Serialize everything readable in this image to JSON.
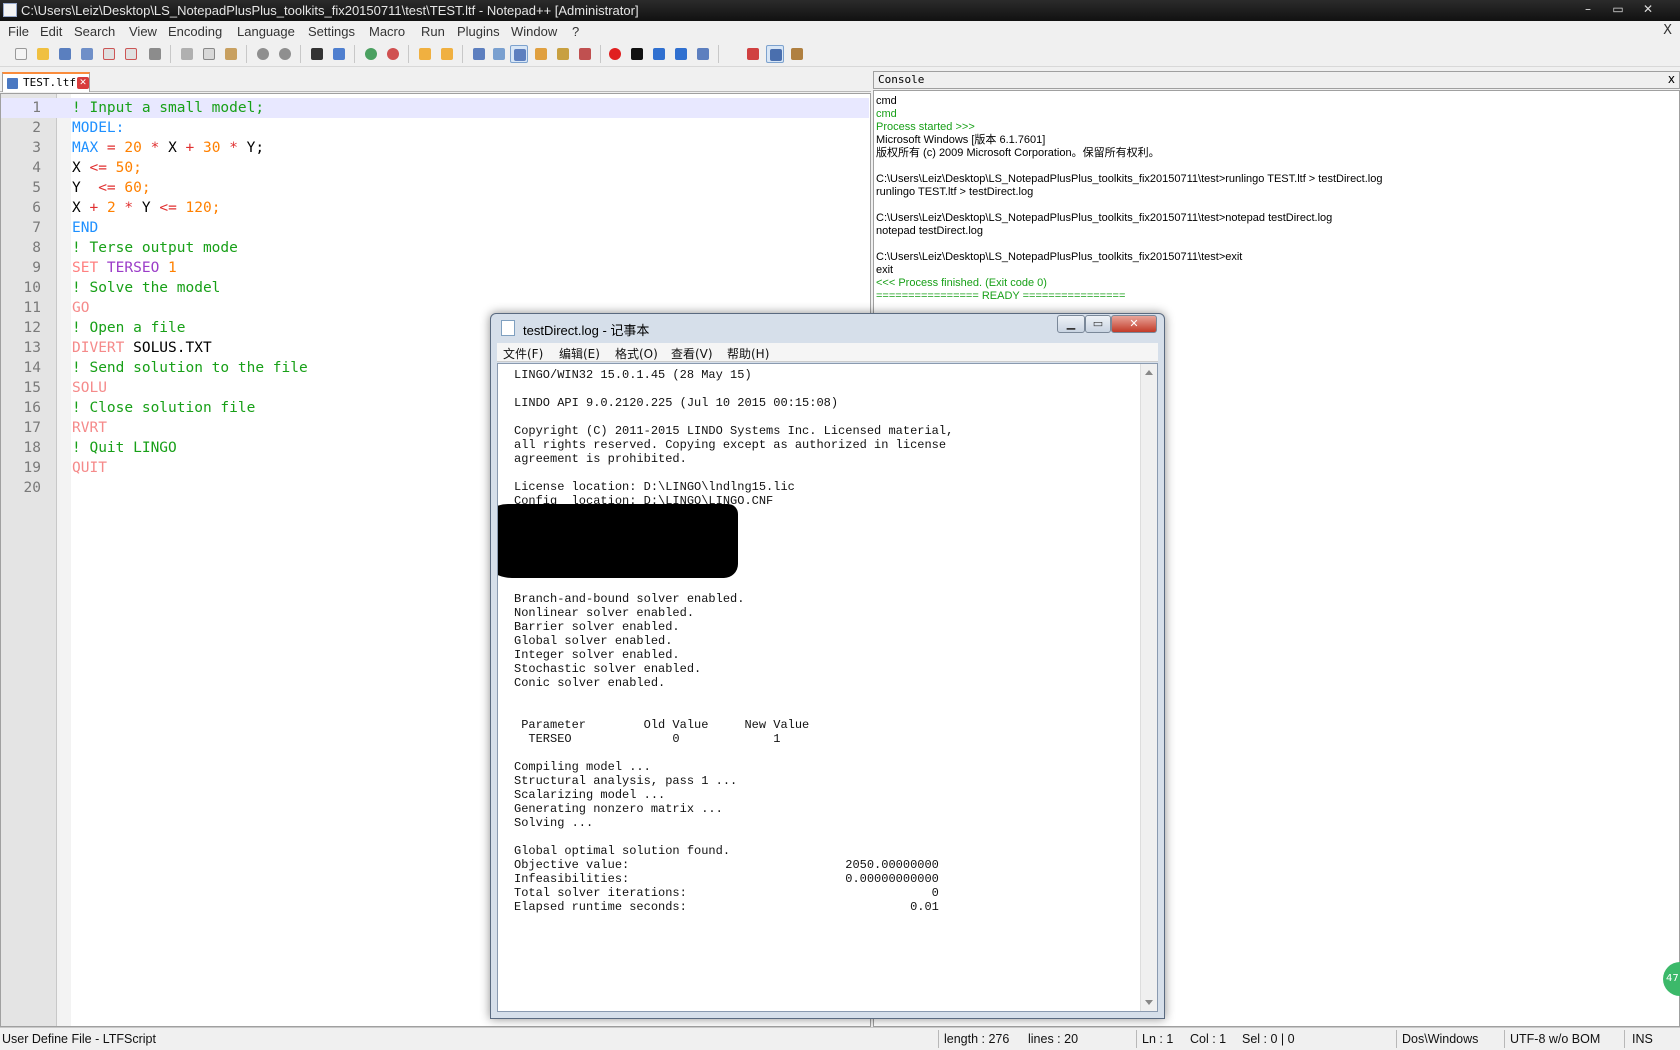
{
  "window": {
    "title": "C:\\Users\\Leiz\\Desktop\\LS_NotepadPlusPlus_toolkits_fix20150711\\test\\TEST.ltf - Notepad++ [Administrator]",
    "minimize": "–",
    "maximize": "▭",
    "close": "✕"
  },
  "menu": [
    "File",
    "Edit",
    "Search",
    "View",
    "Encoding",
    "Language",
    "Settings",
    "Macro",
    "Run",
    "Plugins",
    "Window",
    "?"
  ],
  "menu_close": "X",
  "tab": {
    "label": "TEST.ltf",
    "close": "✕"
  },
  "editor": {
    "lines": [
      [
        [
          "! Input a small model;",
          "comment"
        ]
      ],
      [
        [
          "MODEL:",
          "kw"
        ]
      ],
      [
        [
          "MAX ",
          "kw"
        ],
        [
          "= ",
          "op"
        ],
        [
          "20 ",
          "num"
        ],
        [
          "* ",
          "op"
        ],
        [
          "X ",
          "text"
        ],
        [
          "+ ",
          "op"
        ],
        [
          "30 ",
          "num"
        ],
        [
          "* ",
          "op"
        ],
        [
          "Y;",
          "text"
        ]
      ],
      [
        [
          "X ",
          "text"
        ],
        [
          "<= ",
          "op"
        ],
        [
          "50;",
          "num"
        ]
      ],
      [
        [
          "Y  ",
          "text"
        ],
        [
          "<= ",
          "op"
        ],
        [
          "60;",
          "num"
        ]
      ],
      [
        [
          "X ",
          "text"
        ],
        [
          "+ ",
          "op"
        ],
        [
          "2 ",
          "num"
        ],
        [
          "* ",
          "op"
        ],
        [
          "Y ",
          "text"
        ],
        [
          "<= ",
          "op"
        ],
        [
          "120;",
          "num"
        ]
      ],
      [
        [
          "END",
          "kw"
        ]
      ],
      [
        [
          "! Terse output mode",
          "comment"
        ]
      ],
      [
        [
          "SET ",
          "set"
        ],
        [
          "TERSEO ",
          "purple"
        ],
        [
          "1",
          "num"
        ]
      ],
      [
        [
          "! Solve the model",
          "comment"
        ]
      ],
      [
        [
          "GO",
          "pink"
        ]
      ],
      [
        [
          "! Open a file",
          "comment"
        ]
      ],
      [
        [
          "DIVERT ",
          "pink"
        ],
        [
          "SOLUS.TXT",
          "text"
        ]
      ],
      [
        [
          "! Send solution to the file",
          "comment"
        ]
      ],
      [
        [
          "SOLU",
          "pink"
        ]
      ],
      [
        [
          "! Close solution file",
          "comment"
        ]
      ],
      [
        [
          "RVRT",
          "pink"
        ]
      ],
      [
        [
          "! Quit LINGO",
          "comment"
        ]
      ],
      [
        [
          "QUIT",
          "pink"
        ]
      ],
      []
    ]
  },
  "console": {
    "title": "Console",
    "close": "x",
    "lines": [
      {
        "text": "cmd",
        "style": "black"
      },
      {
        "text": "cmd",
        "style": "green"
      },
      {
        "text": "Process started >>>",
        "style": "green"
      },
      {
        "text": "Microsoft Windows [版本 6.1.7601]",
        "style": "black"
      },
      {
        "text": "版权所有 (c) 2009 Microsoft Corporation。保留所有权利。",
        "style": "black"
      },
      {
        "text": "",
        "style": "black"
      },
      {
        "text": "C:\\Users\\Leiz\\Desktop\\LS_NotepadPlusPlus_toolkits_fix20150711\\test>runlingo TEST.ltf > testDirect.log",
        "style": "black"
      },
      {
        "text": "runlingo TEST.ltf > testDirect.log",
        "style": "black"
      },
      {
        "text": "",
        "style": "black"
      },
      {
        "text": "C:\\Users\\Leiz\\Desktop\\LS_NotepadPlusPlus_toolkits_fix20150711\\test>notepad testDirect.log",
        "style": "black"
      },
      {
        "text": "notepad testDirect.log",
        "style": "black"
      },
      {
        "text": "",
        "style": "black"
      },
      {
        "text": "C:\\Users\\Leiz\\Desktop\\LS_NotepadPlusPlus_toolkits_fix20150711\\test>exit",
        "style": "black"
      },
      {
        "text": "exit",
        "style": "black"
      },
      {
        "text": "<<< Process finished. (Exit code 0)",
        "style": "green"
      },
      {
        "text": "================ READY ================",
        "style": "green"
      }
    ]
  },
  "notepad": {
    "title": "testDirect.log - 记事本",
    "menu": [
      "文件(F)",
      "编辑(E)",
      "格式(O)",
      "查看(V)",
      "帮助(H)"
    ],
    "lines": [
      "LINGO/WIN32 15.0.1.45 (28 May 15)",
      "",
      "LINDO API 9.0.2120.225 (Jul 10 2015 00:15:08)",
      "",
      "Copyright (C) 2011-2015 LINDO Systems Inc. Licensed material,",
      "all rights reserved. Copying except as authorized in license",
      "agreement is prohibited.",
      "",
      "License location: D:\\LINGO\\lndlng15.lic",
      "Config  location: D:\\LINGO\\LINGO.CNF",
      "",
      "",
      "",
      "",
      "",
      "",
      "Branch-and-bound solver enabled.",
      "Nonlinear solver enabled.",
      "Barrier solver enabled.",
      "Global solver enabled.",
      "Integer solver enabled.",
      "Stochastic solver enabled.",
      "Conic solver enabled.",
      "",
      "",
      " Parameter        Old Value     New Value",
      "  TERSEO              0             1",
      "",
      "Compiling model ...",
      "Structural analysis, pass 1 ...",
      "Scalarizing model ...",
      "Generating nonzero matrix ...",
      "Solving ...",
      "",
      "Global optimal solution found.",
      "Objective value:                              2050.00000000",
      "Infeasibilities:                              0.00000000000",
      "Total solver iterations:                                  0",
      "Elapsed runtime seconds:                               0.01"
    ]
  },
  "status": {
    "file_type": "User Define File - LTFScript",
    "length": "length : 276",
    "lines": "lines : 20",
    "ln": "Ln : 1",
    "col": "Col : 1",
    "sel": "Sel : 0 | 0",
    "eol": "Dos\\Windows",
    "encoding": "UTF-8 w/o BOM",
    "mode": "INS"
  },
  "badge": "47",
  "colors": {
    "comment": "#18a018",
    "keyword": "#1e90ff",
    "operator": "#e03030",
    "number": "#ff8000",
    "tab_accent": "#fa8c3c"
  },
  "toolbar_icons": [
    "new-file-icon",
    "open-file-icon",
    "save-icon",
    "save-all-icon",
    "close-icon",
    "close-all-icon",
    "print-icon",
    "cut-icon",
    "copy-icon",
    "paste-icon",
    "undo-icon",
    "redo-icon",
    "find-icon",
    "replace-icon",
    "zoom-in-icon",
    "zoom-out-icon",
    "sync-vertical-icon",
    "sync-horizontal-icon",
    "word-wrap-icon",
    "show-all-chars-icon",
    "indent-guide-icon",
    "user-lang-icon",
    "doc-map-icon",
    "function-list-icon",
    "record-macro-icon",
    "stop-macro-icon",
    "play-macro-icon",
    "run-macro-multiple-icon",
    "save-macro-icon",
    "spell-check-icon",
    "console-icon",
    "plugin-icon"
  ]
}
